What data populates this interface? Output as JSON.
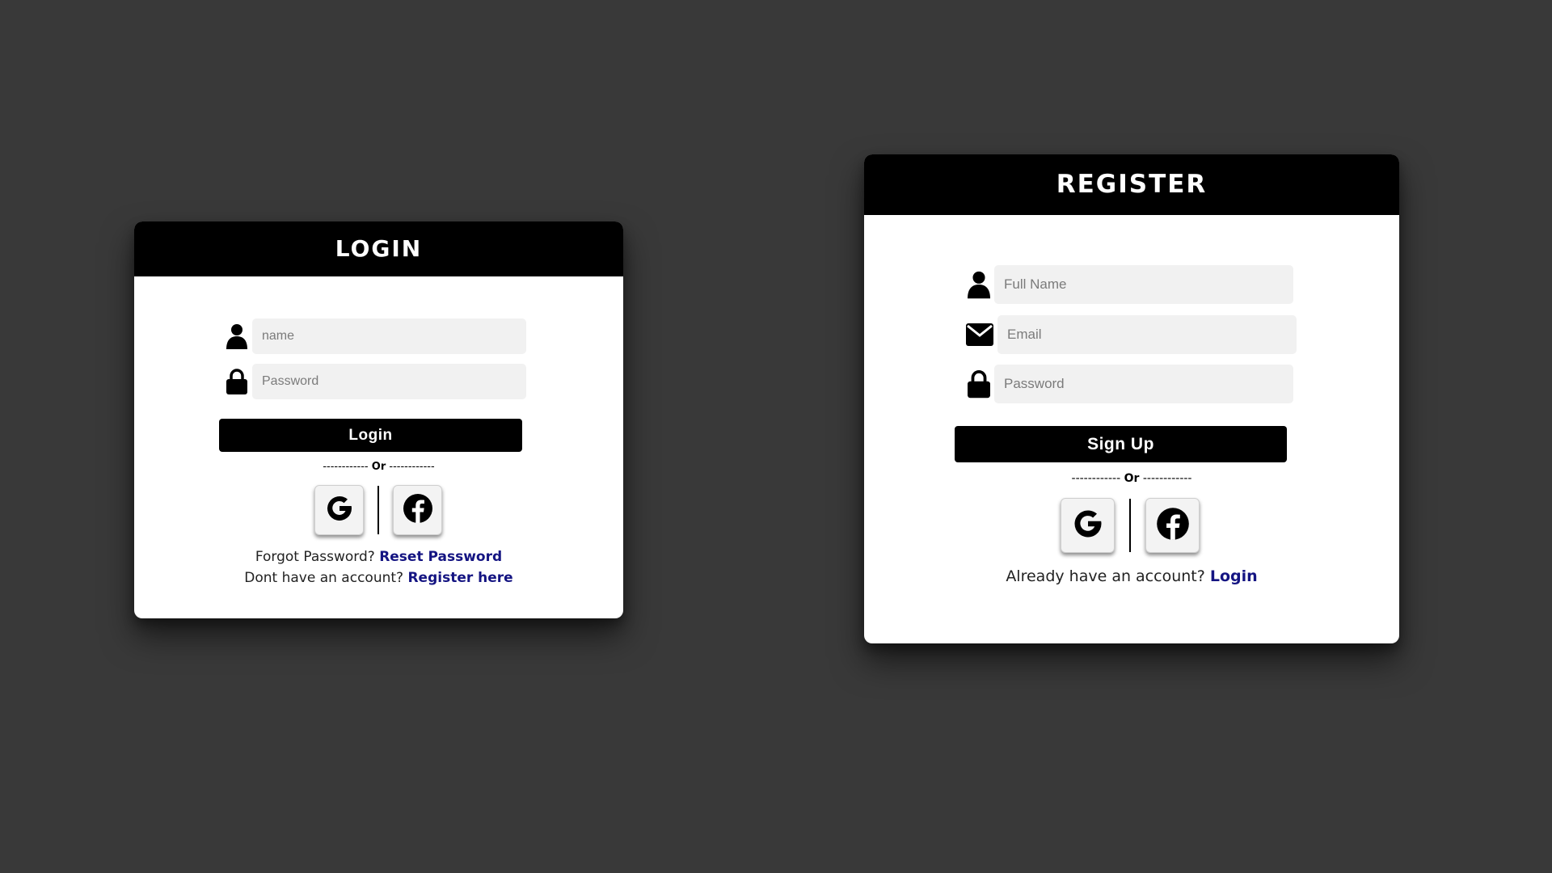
{
  "login": {
    "title": "LOGIN",
    "name_placeholder": "name",
    "password_placeholder": "Password",
    "submit_label": "Login",
    "divider_dashes_left": "------------",
    "divider_or": "Or",
    "divider_dashes_right": "------------",
    "forgot_text": "Forgot Password?",
    "reset_link": "Reset Password",
    "no_account_text": "Dont have an account?",
    "register_link": "Register here"
  },
  "register": {
    "title": "REGISTER",
    "fullname_placeholder": "Full Name",
    "email_placeholder": "Email",
    "password_placeholder": "Password",
    "submit_label": "Sign Up",
    "divider_dashes_left": "------------",
    "divider_or": "Or",
    "divider_dashes_right": "------------",
    "have_account_text": "Already have an account?",
    "login_link": "Login"
  },
  "icons": {
    "user": "user-icon",
    "lock": "lock-icon",
    "envelope": "envelope-icon",
    "google": "google-icon",
    "facebook": "facebook-icon"
  },
  "colors": {
    "background": "#393939",
    "card": "#ffffff",
    "header": "#000000",
    "input_bg": "#f1f1f1",
    "link": "#141482"
  }
}
